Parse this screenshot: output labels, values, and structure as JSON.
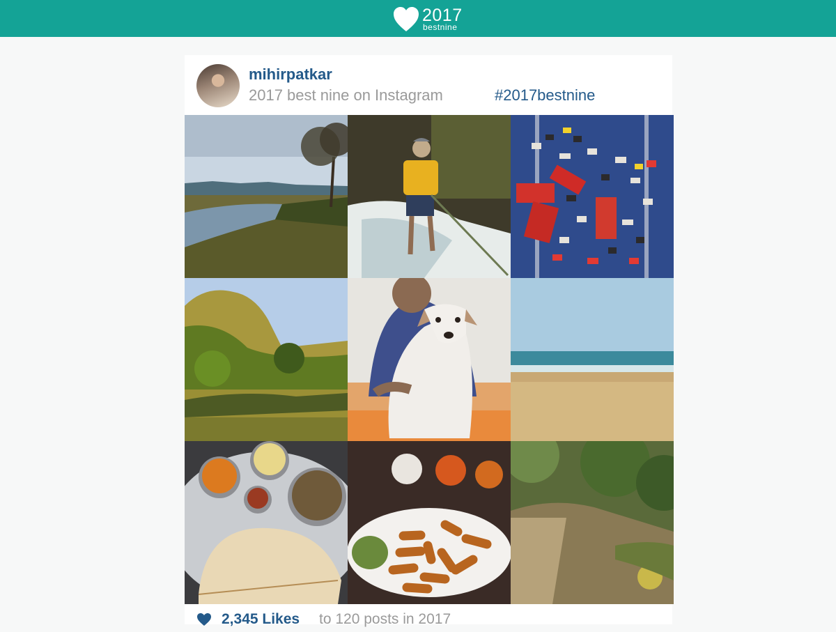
{
  "brand": {
    "year": "2017",
    "word": "bestnine",
    "color": "#14a396",
    "icon": "heart-icon"
  },
  "post": {
    "username": "mihirpatkar",
    "caption": "2017 best nine on Instagram",
    "hashtag": "#2017bestnine",
    "likes": "2,345 Likes",
    "summary": "to 120 posts in 2017"
  },
  "photos": [
    {
      "subject": "river landscape with tree"
    },
    {
      "subject": "rappelling down waterfall"
    },
    {
      "subject": "toy cars on blue cloth"
    },
    {
      "subject": "limestone cliffs and palms"
    },
    {
      "subject": "man with white dog"
    },
    {
      "subject": "beach and sea"
    },
    {
      "subject": "thali meal"
    },
    {
      "subject": "fried snacks with sauces"
    },
    {
      "subject": "forest dirt path"
    }
  ]
}
